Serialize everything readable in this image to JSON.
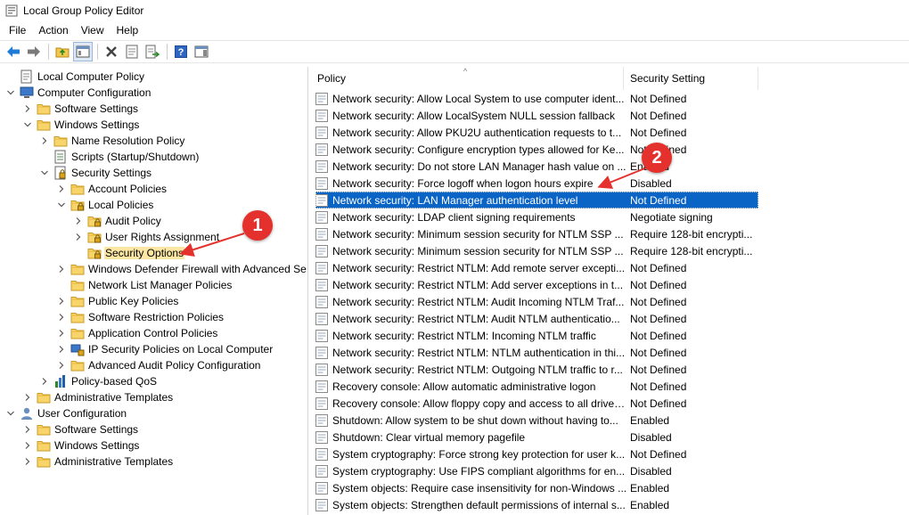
{
  "window": {
    "title": "Local Group Policy Editor"
  },
  "menu": [
    "File",
    "Action",
    "View",
    "Help"
  ],
  "toolbar": [
    "back-arrow-icon",
    "forward-arrow-icon",
    "up-folder-icon",
    "show-hide-tree-icon",
    "delete-icon",
    "properties-icon",
    "export-list-icon",
    "help-icon",
    "show-action-pane-icon"
  ],
  "tree": [
    {
      "label": "Local Computer Policy",
      "icon": "computer-policy-icon",
      "expander": "",
      "level": 0
    },
    {
      "label": "Computer Configuration",
      "icon": "computer-icon",
      "expander": "expanded",
      "level": 0
    },
    {
      "label": "Software Settings",
      "icon": "folder-icon",
      "expander": "collapsed",
      "level": 1
    },
    {
      "label": "Windows Settings",
      "icon": "folder-icon",
      "expander": "expanded",
      "level": 1
    },
    {
      "label": "Name Resolution Policy",
      "icon": "folder-icon",
      "expander": "collapsed",
      "level": 2
    },
    {
      "label": "Scripts (Startup/Shutdown)",
      "icon": "script-icon",
      "expander": "",
      "level": 2
    },
    {
      "label": "Security Settings",
      "icon": "security-settings-icon",
      "expander": "expanded",
      "level": 2
    },
    {
      "label": "Account Policies",
      "icon": "folder-icon",
      "expander": "collapsed",
      "level": 3
    },
    {
      "label": "Local Policies",
      "icon": "folder-lock-icon",
      "expander": "expanded",
      "level": 3
    },
    {
      "label": "Audit Policy",
      "icon": "folder-lock-icon",
      "expander": "collapsed",
      "level": 4
    },
    {
      "label": "User Rights Assignment",
      "icon": "folder-lock-icon",
      "expander": "collapsed",
      "level": 4
    },
    {
      "label": "Security Options",
      "icon": "folder-lock-icon",
      "expander": "",
      "level": 4,
      "selected": true
    },
    {
      "label": "Windows Defender Firewall with Advanced Se",
      "icon": "folder-icon",
      "expander": "collapsed",
      "level": 3
    },
    {
      "label": "Network List Manager Policies",
      "icon": "folder-icon",
      "expander": "",
      "level": 3
    },
    {
      "label": "Public Key Policies",
      "icon": "folder-icon",
      "expander": "collapsed",
      "level": 3
    },
    {
      "label": "Software Restriction Policies",
      "icon": "folder-icon",
      "expander": "collapsed",
      "level": 3
    },
    {
      "label": "Application Control Policies",
      "icon": "folder-icon",
      "expander": "collapsed",
      "level": 3
    },
    {
      "label": "IP Security Policies on Local Computer",
      "icon": "ip-security-icon",
      "expander": "collapsed",
      "level": 3
    },
    {
      "label": "Advanced Audit Policy Configuration",
      "icon": "folder-icon",
      "expander": "collapsed",
      "level": 3
    },
    {
      "label": "Policy-based QoS",
      "icon": "chart-bars-icon",
      "expander": "collapsed",
      "level": 2
    },
    {
      "label": "Administrative Templates",
      "icon": "folder-icon",
      "expander": "collapsed",
      "level": 1
    },
    {
      "label": "User Configuration",
      "icon": "user-icon",
      "expander": "expanded",
      "level": 0
    },
    {
      "label": "Software Settings",
      "icon": "folder-icon",
      "expander": "collapsed",
      "level": 1
    },
    {
      "label": "Windows Settings",
      "icon": "folder-icon",
      "expander": "collapsed",
      "level": 1
    },
    {
      "label": "Administrative Templates",
      "icon": "folder-icon",
      "expander": "collapsed",
      "level": 1
    }
  ],
  "columns": {
    "policy": "Policy",
    "setting": "Security Setting"
  },
  "policies": [
    {
      "name": "Network security: Allow Local System to use computer ident...",
      "setting": "Not Defined"
    },
    {
      "name": "Network security: Allow LocalSystem NULL session fallback",
      "setting": "Not Defined"
    },
    {
      "name": "Network security: Allow PKU2U authentication requests to t...",
      "setting": "Not Defined"
    },
    {
      "name": "Network security: Configure encryption types allowed for Ke...",
      "setting": "Not Defined"
    },
    {
      "name": "Network security: Do not store LAN Manager hash value on ...",
      "setting": "Enabled"
    },
    {
      "name": "Network security: Force logoff when logon hours expire",
      "setting": "Disabled"
    },
    {
      "name": "Network security: LAN Manager authentication level",
      "setting": "Not Defined",
      "selected": true
    },
    {
      "name": "Network security: LDAP client signing requirements",
      "setting": "Negotiate signing"
    },
    {
      "name": "Network security: Minimum session security for NTLM SSP ...",
      "setting": "Require 128-bit encrypti..."
    },
    {
      "name": "Network security: Minimum session security for NTLM SSP ...",
      "setting": "Require 128-bit encrypti..."
    },
    {
      "name": "Network security: Restrict NTLM: Add remote server excepti...",
      "setting": "Not Defined"
    },
    {
      "name": "Network security: Restrict NTLM: Add server exceptions in t...",
      "setting": "Not Defined"
    },
    {
      "name": "Network security: Restrict NTLM: Audit Incoming NTLM Traf...",
      "setting": "Not Defined"
    },
    {
      "name": "Network security: Restrict NTLM: Audit NTLM authenticatio...",
      "setting": "Not Defined"
    },
    {
      "name": "Network security: Restrict NTLM: Incoming NTLM traffic",
      "setting": "Not Defined"
    },
    {
      "name": "Network security: Restrict NTLM: NTLM authentication in thi...",
      "setting": "Not Defined"
    },
    {
      "name": "Network security: Restrict NTLM: Outgoing NTLM traffic to r...",
      "setting": "Not Defined"
    },
    {
      "name": "Recovery console: Allow automatic administrative logon",
      "setting": "Not Defined"
    },
    {
      "name": "Recovery console: Allow floppy copy and access to all drives...",
      "setting": "Not Defined"
    },
    {
      "name": "Shutdown: Allow system to be shut down without having to...",
      "setting": "Enabled"
    },
    {
      "name": "Shutdown: Clear virtual memory pagefile",
      "setting": "Disabled"
    },
    {
      "name": "System cryptography: Force strong key protection for user k...",
      "setting": "Not Defined"
    },
    {
      "name": "System cryptography: Use FIPS compliant algorithms for en...",
      "setting": "Disabled"
    },
    {
      "name": "System objects: Require case insensitivity for non-Windows ...",
      "setting": "Enabled"
    },
    {
      "name": "System objects: Strengthen default permissions of internal s...",
      "setting": "Enabled"
    }
  ],
  "annotations": [
    {
      "number": "1",
      "target": "Security Options"
    },
    {
      "number": "2",
      "target": "Network security: LAN Manager authentication level"
    }
  ],
  "colors": {
    "selection": "#0a64c6",
    "tree_selection": "#fbe7a3",
    "callout": "#e5312d"
  }
}
